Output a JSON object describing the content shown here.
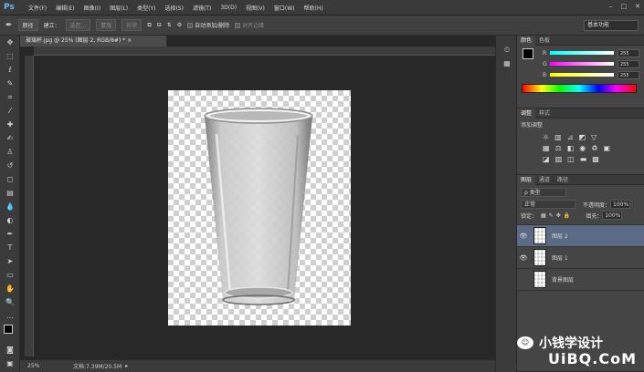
{
  "app": {
    "logo": "Ps"
  },
  "menu": [
    "文件(F)",
    "编辑(E)",
    "图像(I)",
    "图层(L)",
    "类型(Y)",
    "选择(S)",
    "滤镜(T)",
    "3D(D)",
    "视图(V)",
    "窗口(W)",
    "帮助(H)"
  ],
  "options_bar": {
    "mode_select": "颜径",
    "build_label": "建立：",
    "btn_selection": "选区...",
    "btn_mask": "蒙版",
    "btn_shape": "形状",
    "auto_add_delete": "自动添加/删除",
    "align_edges": "对齐边缘",
    "workspace": "基本功能"
  },
  "document": {
    "tab_title": "玻璃杯.jpg @ 25% (图层 2, RGB/8#) *",
    "zoom": "25%",
    "doc_size": "文档:7.39M/20.5M"
  },
  "color_panel": {
    "tabs": [
      "颜色",
      "色板"
    ],
    "channels": [
      {
        "label": "R",
        "value": "255"
      },
      {
        "label": "G",
        "value": "255"
      },
      {
        "label": "B",
        "value": "255"
      }
    ]
  },
  "adjustments_panel": {
    "tabs": [
      "调整",
      "样式"
    ],
    "title": "添加调整"
  },
  "layers_panel": {
    "tabs": [
      "图层",
      "通道",
      "路径"
    ],
    "filter": "ρ 类型",
    "blend_mode": "正常",
    "opacity_label": "不透明度：",
    "opacity": "100%",
    "lock_label": "锁定：",
    "fill_label": "填充：",
    "fill": "100%",
    "layers": [
      {
        "name": "图层 2",
        "selected": true
      },
      {
        "name": "图层 1",
        "selected": false
      },
      {
        "name": "背景图层",
        "selected": false
      }
    ]
  },
  "watermark": {
    "text1": "小钱学设计",
    "text2": "UiBQ.CoM"
  }
}
